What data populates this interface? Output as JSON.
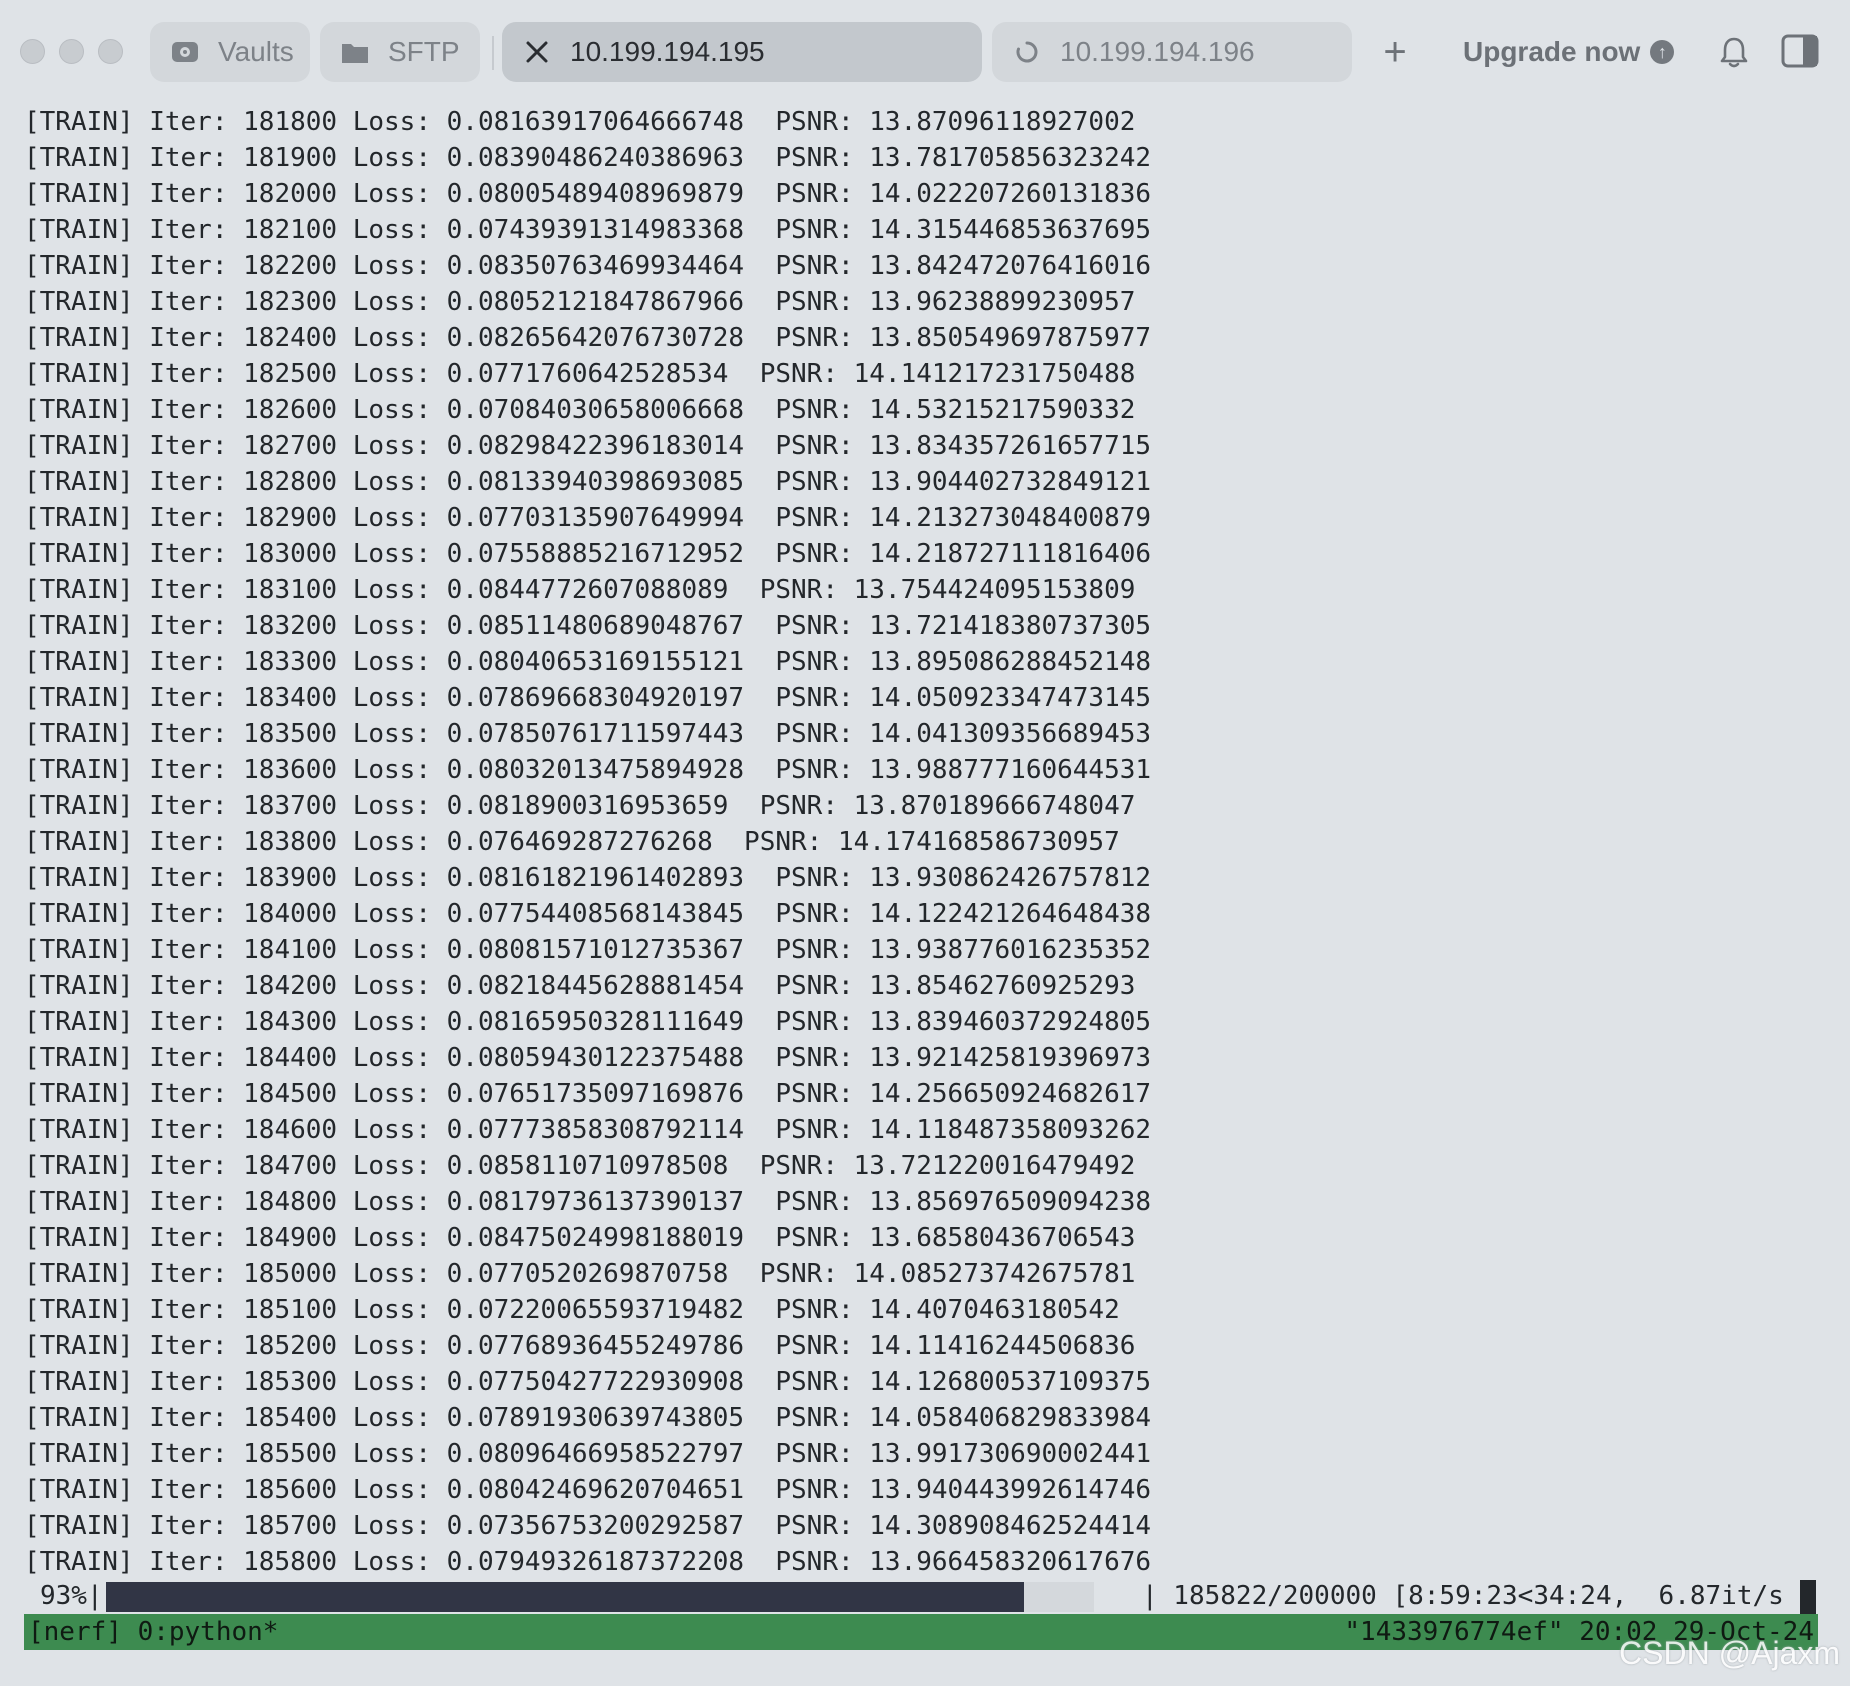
{
  "tabs": [
    {
      "label": "Vaults",
      "icon": "vault-icon"
    },
    {
      "label": "SFTP",
      "icon": "folder-icon"
    },
    {
      "label": "10.199.194.195",
      "icon": "close-icon"
    },
    {
      "label": "10.199.194.196",
      "icon": "loading-icon"
    }
  ],
  "toolbar": {
    "upgrade_label": "Upgrade now",
    "upgrade_badge": "↑"
  },
  "log_lines": [
    "[TRAIN] Iter: 181800 Loss: 0.08163917064666748  PSNR: 13.87096118927002",
    "[TRAIN] Iter: 181900 Loss: 0.08390486240386963  PSNR: 13.781705856323242",
    "[TRAIN] Iter: 182000 Loss: 0.08005489408969879  PSNR: 14.022207260131836",
    "[TRAIN] Iter: 182100 Loss: 0.07439391314983368  PSNR: 14.315446853637695",
    "[TRAIN] Iter: 182200 Loss: 0.08350763469934464  PSNR: 13.842472076416016",
    "[TRAIN] Iter: 182300 Loss: 0.08052121847867966  PSNR: 13.96238899230957",
    "[TRAIN] Iter: 182400 Loss: 0.08265642076730728  PSNR: 13.850549697875977",
    "[TRAIN] Iter: 182500 Loss: 0.0771760642528534  PSNR: 14.141217231750488",
    "[TRAIN] Iter: 182600 Loss: 0.07084030658006668  PSNR: 14.53215217590332",
    "[TRAIN] Iter: 182700 Loss: 0.08298422396183014  PSNR: 13.834357261657715",
    "[TRAIN] Iter: 182800 Loss: 0.08133940398693085  PSNR: 13.904402732849121",
    "[TRAIN] Iter: 182900 Loss: 0.07703135907649994  PSNR: 14.213273048400879",
    "[TRAIN] Iter: 183000 Loss: 0.07558885216712952  PSNR: 14.218727111816406",
    "[TRAIN] Iter: 183100 Loss: 0.0844772607088089  PSNR: 13.754424095153809",
    "[TRAIN] Iter: 183200 Loss: 0.08511480689048767  PSNR: 13.721418380737305",
    "[TRAIN] Iter: 183300 Loss: 0.08040653169155121  PSNR: 13.895086288452148",
    "[TRAIN] Iter: 183400 Loss: 0.07869668304920197  PSNR: 14.050923347473145",
    "[TRAIN] Iter: 183500 Loss: 0.07850761711597443  PSNR: 14.041309356689453",
    "[TRAIN] Iter: 183600 Loss: 0.08032013475894928  PSNR: 13.988777160644531",
    "[TRAIN] Iter: 183700 Loss: 0.0818900316953659  PSNR: 13.870189666748047",
    "[TRAIN] Iter: 183800 Loss: 0.076469287276268  PSNR: 14.174168586730957",
    "[TRAIN] Iter: 183900 Loss: 0.08161821961402893  PSNR: 13.930862426757812",
    "[TRAIN] Iter: 184000 Loss: 0.07754408568143845  PSNR: 14.122421264648438",
    "[TRAIN] Iter: 184100 Loss: 0.08081571012735367  PSNR: 13.938776016235352",
    "[TRAIN] Iter: 184200 Loss: 0.08218445628881454  PSNR: 13.85462760925293",
    "[TRAIN] Iter: 184300 Loss: 0.08165950328111649  PSNR: 13.839460372924805",
    "[TRAIN] Iter: 184400 Loss: 0.08059430122375488  PSNR: 13.921425819396973",
    "[TRAIN] Iter: 184500 Loss: 0.07651735097169876  PSNR: 14.256650924682617",
    "[TRAIN] Iter: 184600 Loss: 0.07773858308792114  PSNR: 14.118487358093262",
    "[TRAIN] Iter: 184700 Loss: 0.0858110710978508  PSNR: 13.721220016479492",
    "[TRAIN] Iter: 184800 Loss: 0.08179736137390137  PSNR: 13.856976509094238",
    "[TRAIN] Iter: 184900 Loss: 0.08475024998188019  PSNR: 13.68580436706543",
    "[TRAIN] Iter: 185000 Loss: 0.0770520269870758  PSNR: 14.085273742675781",
    "[TRAIN] Iter: 185100 Loss: 0.07220065593719482  PSNR: 14.4070463180542",
    "[TRAIN] Iter: 185200 Loss: 0.07768936455249786  PSNR: 14.11416244506836",
    "[TRAIN] Iter: 185300 Loss: 0.07750427722930908  PSNR: 14.126800537109375",
    "[TRAIN] Iter: 185400 Loss: 0.07891930639743805  PSNR: 14.058406829833984",
    "[TRAIN] Iter: 185500 Loss: 0.08096466958522797  PSNR: 13.991730690002441",
    "[TRAIN] Iter: 185600 Loss: 0.08042469620704651  PSNR: 13.940443992614746",
    "[TRAIN] Iter: 185700 Loss: 0.07356753200292587  PSNR: 14.308908462524414",
    "[TRAIN] Iter: 185800 Loss: 0.07949326187372208  PSNR: 13.966458320617676"
  ],
  "progress": {
    "percent_label": "93%|",
    "fraction": 0.929,
    "detail": "| 185822/200000 [8:59:23<34:24,  6.87it/s"
  },
  "statusbar": {
    "session": "[nerf] 0:python*",
    "right": "\"1433976774ef\" 20:02 29-Oct-24"
  },
  "watermark": "CSDN @Ajaxm",
  "colors": {
    "statusbar_bg": "#3d8b50",
    "progress_fill": "#313545",
    "background": "#dfe3e7"
  }
}
